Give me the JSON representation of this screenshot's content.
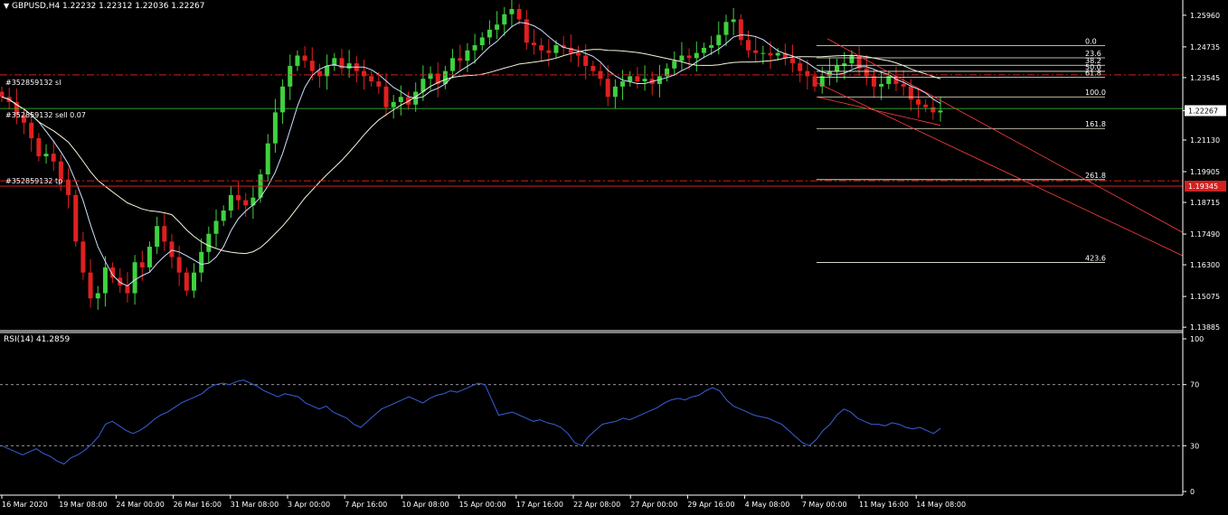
{
  "header": {
    "caret": "▼",
    "title": "GBPUSD,H4  1.22232 1.22312 1.22036 1.22267"
  },
  "orders": {
    "sl_label": "#352859132 sl",
    "open_label": "#352859132 sell 0.07",
    "tp_label": "#352859132 tp"
  },
  "rsi_panel": {
    "title": "RSI(14) 41.2859"
  },
  "chart_data": [
    {
      "type": "candlestick",
      "title": "GBPUSD,H4",
      "symbol": "GBPUSD",
      "timeframe": "H4",
      "ohlc_readout": {
        "open": 1.22232,
        "high": 1.22312,
        "low": 1.22036,
        "close": 1.22267
      },
      "y_ticks": [
        "1.25960",
        "1.24735",
        "1.23545",
        "1.22267",
        "1.21130",
        "1.19905",
        "1.18715",
        "1.17490",
        "1.16300",
        "1.15075",
        "1.13885"
      ],
      "ylim": [
        1.1375,
        1.2655
      ],
      "x_ticks": [
        "16 Mar 2020",
        "19 Mar 08:00",
        "24 Mar 00:00",
        "26 Mar 16:00",
        "31 Mar 08:00",
        "3 Apr 00:00",
        "7 Apr 16:00",
        "10 Apr 08:00",
        "15 Apr 00:00",
        "17 Apr 16:00",
        "22 Apr 08:00",
        "27 Apr 00:00",
        "29 Apr 16:00",
        "4 May 08:00",
        "7 May 00:00",
        "11 May 16:00",
        "14 May 08:00"
      ],
      "current_price": "1.22267",
      "tp_price": "1.19345",
      "close_path": [
        1.228,
        1.226,
        1.221,
        1.218,
        1.212,
        1.205,
        1.206,
        1.203,
        1.196,
        1.19,
        1.172,
        1.16,
        1.15,
        1.152,
        1.162,
        1.158,
        1.155,
        1.152,
        1.164,
        1.162,
        1.17,
        1.178,
        1.172,
        1.166,
        1.16,
        1.153,
        1.16,
        1.168,
        1.175,
        1.18,
        1.184,
        1.19,
        1.188,
        1.186,
        1.189,
        1.198,
        1.21,
        1.222,
        1.232,
        1.24,
        1.244,
        1.242,
        1.238,
        1.236,
        1.24,
        1.243,
        1.239,
        1.241,
        1.238,
        1.236,
        1.234,
        1.232,
        1.224,
        1.226,
        1.228,
        1.225,
        1.23,
        1.235,
        1.237,
        1.233,
        1.238,
        1.243,
        1.242,
        1.246,
        1.248,
        1.251,
        1.254,
        1.256,
        1.26,
        1.262,
        1.258,
        1.249,
        1.248,
        1.246,
        1.245,
        1.248,
        1.247,
        1.245,
        1.244,
        1.24,
        1.238,
        1.235,
        1.228,
        1.232,
        1.234,
        1.236,
        1.234,
        1.235,
        1.233,
        1.236,
        1.239,
        1.242,
        1.244,
        1.243,
        1.245,
        1.247,
        1.248,
        1.252,
        1.257,
        1.258,
        1.25,
        1.246,
        1.245,
        1.245,
        1.244,
        1.245,
        1.243,
        1.241,
        1.238,
        1.236,
        1.232,
        1.236,
        1.238,
        1.24,
        1.241,
        1.244,
        1.239,
        1.236,
        1.232,
        1.233,
        1.236,
        1.233,
        1.232,
        1.227,
        1.225,
        1.224,
        1.222,
        1.2227
      ],
      "overlays": {
        "moving_averages": [
          "fast",
          "slow"
        ],
        "fibonacci_levels": [
          "0.0",
          "23.6",
          "38.2",
          "50.0",
          "61.8",
          "100.0",
          "161.8",
          "261.8",
          "423.6"
        ],
        "channel": "descending"
      }
    },
    {
      "type": "line",
      "title": "RSI(14) 41.2859",
      "name": "RSI(14)",
      "last_value": 41.2859,
      "y_ticks": [
        "100",
        "70",
        "30",
        "0"
      ],
      "ylim": [
        0,
        100
      ],
      "levels": [
        70,
        30
      ],
      "values": [
        30,
        28,
        26,
        24,
        26,
        28,
        25,
        23,
        20,
        18,
        22,
        24,
        27,
        31,
        36,
        44,
        46,
        43,
        40,
        38,
        40,
        43,
        47,
        50,
        52,
        55,
        58,
        60,
        62,
        64,
        68,
        70,
        71,
        70,
        72,
        73,
        71,
        69,
        66,
        64,
        62,
        64,
        63,
        62,
        58,
        56,
        54,
        56,
        52,
        50,
        48,
        44,
        42,
        46,
        50,
        54,
        56,
        58,
        60,
        62,
        60,
        58,
        61,
        63,
        64,
        66,
        65,
        67,
        69,
        71,
        70,
        60,
        50,
        51,
        52,
        50,
        48,
        46,
        47,
        45,
        44,
        42,
        38,
        32,
        30,
        36,
        40,
        44,
        45,
        46,
        48,
        47,
        49,
        51,
        53,
        55,
        58,
        60,
        61,
        60,
        62,
        63,
        66,
        68,
        66,
        60,
        56,
        54,
        52,
        50,
        49,
        48,
        46,
        44,
        40,
        36,
        32,
        30,
        34,
        40,
        44,
        50,
        54,
        52,
        48,
        46,
        44,
        44,
        43,
        45,
        44,
        42,
        41,
        42,
        40,
        38,
        41.29
      ]
    }
  ]
}
